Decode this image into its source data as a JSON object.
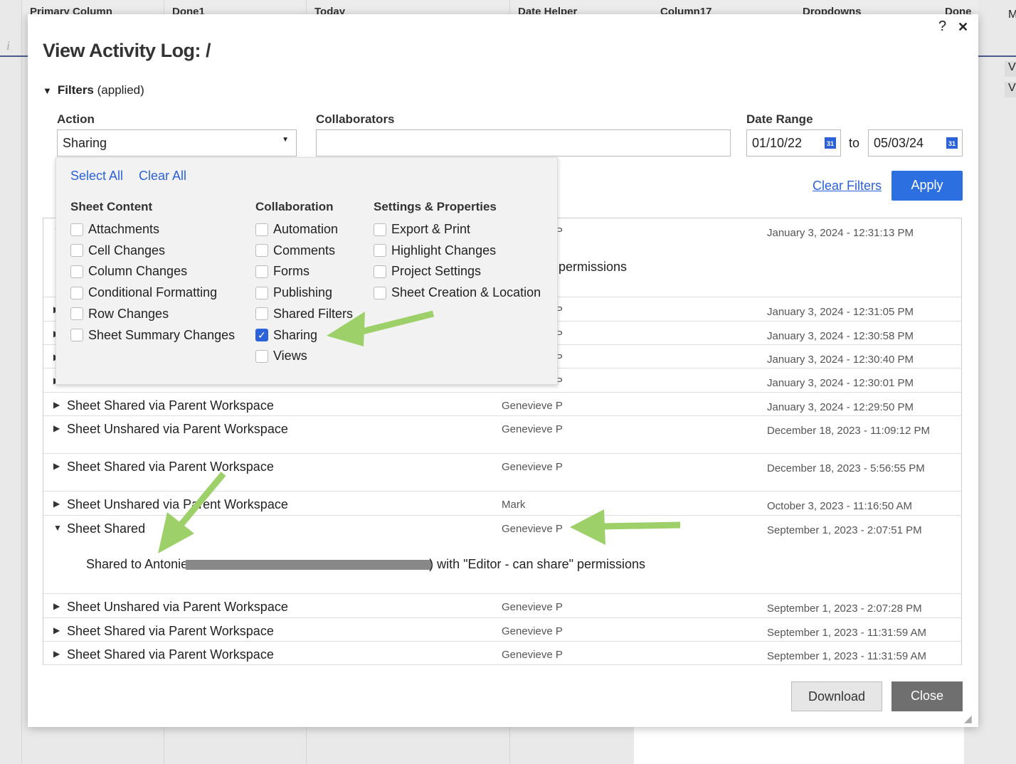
{
  "background": {
    "columns": [
      "Primary Column",
      "Done1",
      "Today",
      "Date Helper",
      "Column17",
      "Dropdowns",
      "Done"
    ],
    "right_letters": [
      "M",
      "V",
      "V"
    ],
    "info_icon": "info-icon"
  },
  "dialog": {
    "title": "View Activity Log: /",
    "help": "?",
    "close": "✕",
    "filters": {
      "label": "Filters",
      "status": "(applied)"
    },
    "action": {
      "label": "Action",
      "value": "Sharing"
    },
    "collaborators": {
      "label": "Collaborators",
      "value": ""
    },
    "date_range": {
      "label": "Date Range",
      "from": "01/10/22",
      "to_label": "to",
      "to": "05/03/24"
    },
    "clear_filters": "Clear Filters",
    "apply": "Apply",
    "dropdown": {
      "select_all": "Select All",
      "clear_all": "Clear All",
      "groups": [
        {
          "title": "Sheet Content",
          "items": [
            {
              "label": "Attachments",
              "checked": false
            },
            {
              "label": "Cell Changes",
              "checked": false
            },
            {
              "label": "Column Changes",
              "checked": false
            },
            {
              "label": "Conditional Formatting",
              "checked": false
            },
            {
              "label": "Row Changes",
              "checked": false
            },
            {
              "label": "Sheet Summary Changes",
              "checked": false
            }
          ]
        },
        {
          "title": "Collaboration",
          "items": [
            {
              "label": "Automation",
              "checked": false
            },
            {
              "label": "Comments",
              "checked": false
            },
            {
              "label": "Forms",
              "checked": false
            },
            {
              "label": "Publishing",
              "checked": false
            },
            {
              "label": "Shared Filters",
              "checked": false
            },
            {
              "label": "Sharing",
              "checked": true
            },
            {
              "label": "Views",
              "checked": false
            }
          ]
        },
        {
          "title": "Settings & Properties",
          "items": [
            {
              "label": "Export & Print",
              "checked": false
            },
            {
              "label": "Highlight Changes",
              "checked": false
            },
            {
              "label": "Project Settings",
              "checked": false
            },
            {
              "label": "Sheet Creation & Location",
              "checked": false
            }
          ]
        }
      ]
    },
    "rows": [
      {
        "action": "",
        "user": "Genevieve P",
        "date": "January 3, 2024 - 12:31:13 PM",
        "expanded": true,
        "detail": "permissions"
      },
      {
        "action": "",
        "user": "Genevieve P",
        "date": "January 3, 2024 - 12:31:05 PM"
      },
      {
        "action": "",
        "user": "Genevieve P",
        "date": "January 3, 2024 - 12:30:58 PM"
      },
      {
        "action": "",
        "user": "Genevieve P",
        "date": "January 3, 2024 - 12:30:40 PM"
      },
      {
        "action": "",
        "user": "Genevieve P",
        "date": "January 3, 2024 - 12:30:01 PM"
      },
      {
        "action": "Sheet Shared via Parent Workspace",
        "user": "Genevieve P",
        "date": "January 3, 2024 - 12:29:50 PM"
      },
      {
        "action": "Sheet Unshared via Parent Workspace",
        "user": "Genevieve P",
        "date": "December 18, 2023 - 11:09:12 PM"
      },
      {
        "action": "Sheet Shared via Parent Workspace",
        "user": "Genevieve P",
        "date": "December 18, 2023 - 5:56:55 PM"
      },
      {
        "action": "Sheet Unshared via Parent Workspace",
        "user": "Mark",
        "date": "October 3, 2023 - 11:16:50 AM"
      },
      {
        "action": "Sheet Shared",
        "user": "Genevieve P",
        "date": "September 1, 2023 - 2:07:51 PM",
        "expanded": true,
        "detail_pre": "Shared to Antonie",
        "detail_post": ") with \"Editor - can share\" permissions"
      },
      {
        "action": "Sheet Unshared via Parent Workspace",
        "user": "Genevieve P",
        "date": "September 1, 2023 - 2:07:28 PM"
      },
      {
        "action": "Sheet Shared via Parent Workspace",
        "user": "Genevieve P",
        "date": "September 1, 2023 - 11:31:59 AM"
      },
      {
        "action": "Sheet Shared via Parent Workspace",
        "user": "Genevieve P",
        "date": "September 1, 2023 - 11:31:59 AM"
      }
    ],
    "download": "Download",
    "close_button": "Close",
    "annotation_color": "#9dd068"
  }
}
